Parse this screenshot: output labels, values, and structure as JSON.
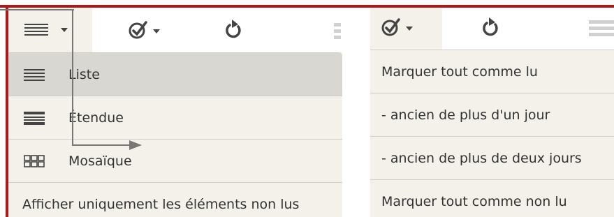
{
  "left_menu": {
    "items": [
      {
        "label": "Liste",
        "icon": "list-icon",
        "selected": true
      },
      {
        "label": "Étendue",
        "icon": "expanded-view-icon",
        "selected": false
      },
      {
        "label": "Mosaïque",
        "icon": "mosaic-grid-icon",
        "selected": false
      },
      {
        "label": "Afficher uniquement les éléments non lus",
        "icon": "",
        "selected": false
      }
    ]
  },
  "right_menu": {
    "items": [
      {
        "label": "Marquer tout comme lu"
      },
      {
        "label": "- ancien de plus d'un jour"
      },
      {
        "label": "- ancien de plus de deux jours"
      },
      {
        "label": "Marquer tout comme non lu"
      }
    ]
  },
  "toolbar": {
    "view_icon": "list-icon",
    "mark_read_icon": "check-circle-icon",
    "refresh_icon": "refresh-icon",
    "dropdown_icon": "caret-down-icon",
    "grip_icon": "drag-handle-icon"
  },
  "colors": {
    "accent_border": "#b01717",
    "menu_background": "#f3f1ea",
    "selected_background": "#d9d7d1",
    "text": "#333333",
    "icon": "#444444"
  }
}
